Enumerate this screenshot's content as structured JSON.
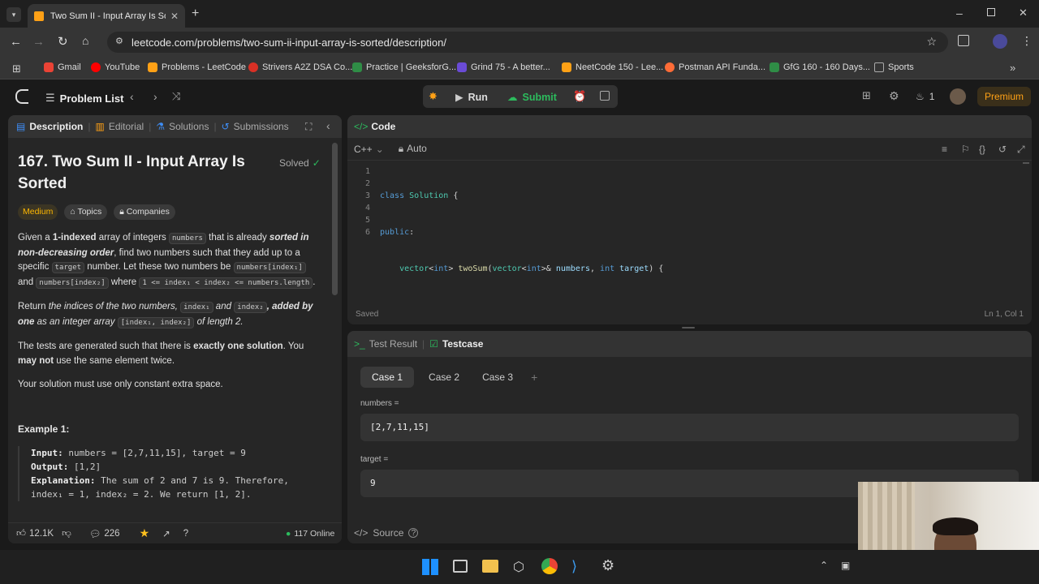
{
  "browser": {
    "tab_title": "Two Sum II - Input Array Is Sorted",
    "url": "leetcode.com/problems/two-sum-ii-input-array-is-sorted/description/",
    "bookmarks": [
      {
        "label": "Gmail",
        "color": "#ea4335"
      },
      {
        "label": "YouTube",
        "color": "#ff0000"
      },
      {
        "label": "Problems - LeetCode",
        "color": "#ffa116"
      },
      {
        "label": "Strivers A2Z DSA Co...",
        "color": "#d93025"
      },
      {
        "label": "Practice | GeeksforG...",
        "color": "#2f8d46"
      },
      {
        "label": "Grind 75 - A better...",
        "color": "#6a4bd6"
      },
      {
        "label": "NeetCode 150 - Lee...",
        "color": "#ffa116"
      },
      {
        "label": "Postman API Funda...",
        "color": "#ff6c37"
      },
      {
        "label": "GfG 160 - 160 Days...",
        "color": "#2f8d46"
      },
      {
        "label": "Sports",
        "color": "#888888"
      }
    ]
  },
  "lcnav": {
    "problem_list": "Problem List",
    "run": "Run",
    "submit": "Submit",
    "streak": "1",
    "premium": "Premium"
  },
  "left_tabs": {
    "description": "Description",
    "editorial": "Editorial",
    "solutions": "Solutions",
    "submissions": "Submissions"
  },
  "problem": {
    "title_line1": "167. Two Sum II - Input Array Is",
    "title_line2": "Sorted",
    "status": "Solved",
    "difficulty": "Medium",
    "topics": "Topics",
    "companies": "Companies",
    "p1_a": "Given a ",
    "p1_b": "1-indexed",
    "p1_c": " array of integers ",
    "p1_d": "numbers",
    "p1_e": " that is already ",
    "p1_f": "sorted in non-decreasing order",
    "p1_g": ", find two numbers such that they add up to a specific ",
    "p1_h": "target",
    "p1_i": " number. Let these two numbers be ",
    "p1_j": "numbers[index₁]",
    "p1_k": " and ",
    "p1_l": "numbers[index₂]",
    "p1_m": " where ",
    "p1_n": "1 <= index₁ < index₂ <= numbers.length",
    "p1_o": ".",
    "p2_a": "Return ",
    "p2_b": "the indices of the two numbers, ",
    "p2_c": "index₁",
    "p2_d": " and ",
    "p2_e": "index₂",
    "p2_f": ", added by one",
    "p2_g": " as an integer array ",
    "p2_h": "[index₁, index₂]",
    "p2_i": " of length 2.",
    "p3_a": "The tests are generated such that there is ",
    "p3_b": "exactly one solution",
    "p3_c": ". You ",
    "p3_d": "may not",
    "p3_e": " use the same element twice.",
    "p4": "Your solution must use only constant extra space.",
    "example_title": "Example 1:",
    "ex_input_label": "Input:",
    "ex_input": " numbers = [2,7,11,15], target = 9",
    "ex_output_label": "Output:",
    "ex_output": " [1,2]",
    "ex_expl_label": "Explanation:",
    "ex_expl1": " The sum of 2 and 7 is 9. Therefore,",
    "ex_expl2": "index₁ = 1, index₂ = 2. We return [1, 2]."
  },
  "footer": {
    "likes": "12.1K",
    "comments": "226",
    "online": "117 Online"
  },
  "code_panel": {
    "title": "Code",
    "language": "C++",
    "auto": "Auto",
    "saved": "Saved",
    "position": "Ln 1, Col 1",
    "line_numbers": [
      "1",
      "2",
      "3",
      "4",
      "5",
      "6"
    ]
  },
  "test_panel": {
    "test_result": "Test Result",
    "testcase": "Testcase",
    "cases": [
      "Case 1",
      "Case 2",
      "Case 3"
    ],
    "add": "+",
    "numbers_label": "numbers =",
    "numbers_value": "[2,7,11,15]",
    "target_label": "target =",
    "target_value": "9",
    "source": "Source"
  }
}
